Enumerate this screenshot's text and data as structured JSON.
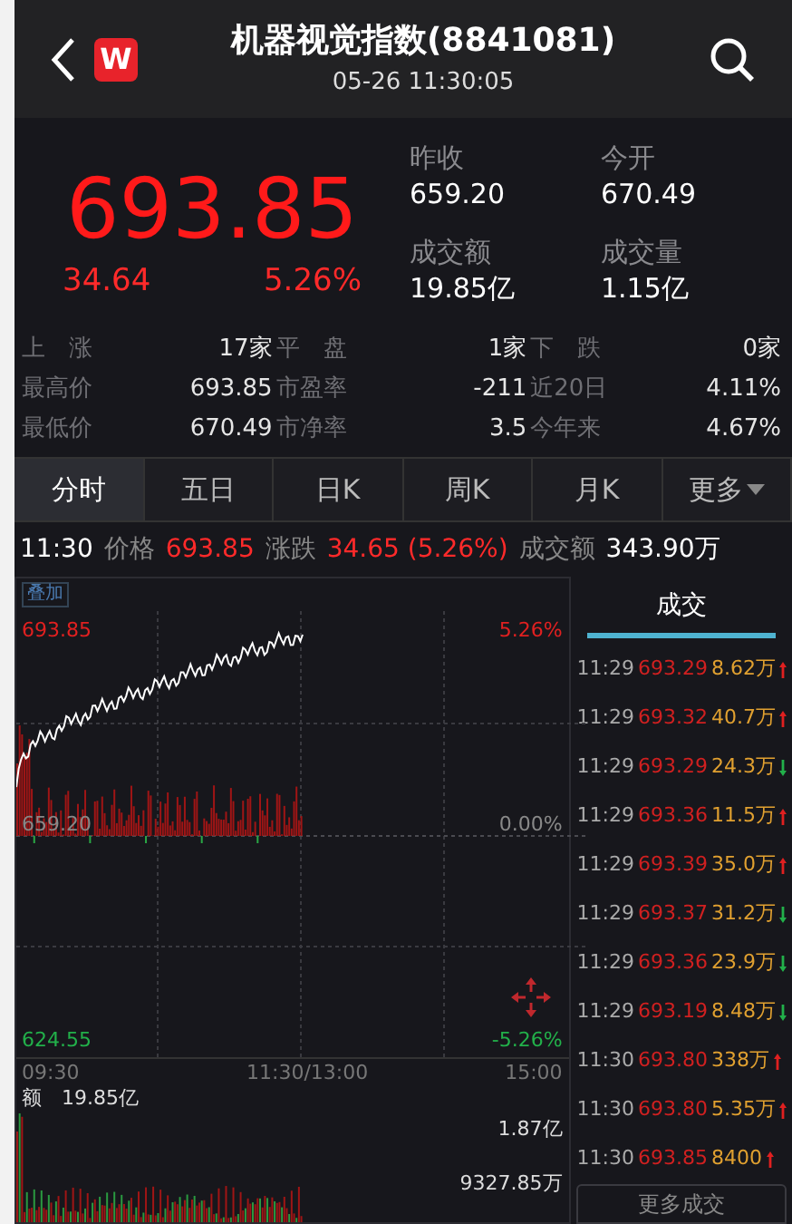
{
  "header": {
    "title": "机器视觉指数(8841081)",
    "time": "05-26 11:30:05",
    "logo": "W"
  },
  "quote": {
    "price": "693.85",
    "change": "34.64",
    "change_pct": "5.26%"
  },
  "summary": [
    {
      "label": "昨收",
      "value": "659.20"
    },
    {
      "label": "今开",
      "value": "670.49"
    },
    {
      "label": "成交额",
      "value": "19.85亿"
    },
    {
      "label": "成交量",
      "value": "1.15亿"
    }
  ],
  "stats": [
    [
      {
        "label": "上　涨",
        "value": "17家"
      },
      {
        "label": "平　盘",
        "value": "1家"
      },
      {
        "label": "下　跌",
        "value": "0家"
      }
    ],
    [
      {
        "label": "最高价",
        "value": "693.85"
      },
      {
        "label": "市盈率",
        "value": "-211"
      },
      {
        "label": "近20日",
        "value": "4.11%"
      }
    ],
    [
      {
        "label": "最低价",
        "value": "670.49"
      },
      {
        "label": "市净率",
        "value": "3.5"
      },
      {
        "label": "今年来",
        "value": "4.67%"
      }
    ]
  ],
  "tabs": [
    {
      "label": "分时",
      "selected": true
    },
    {
      "label": "五日",
      "selected": false
    },
    {
      "label": "日K",
      "selected": false
    },
    {
      "label": "周K",
      "selected": false
    },
    {
      "label": "月K",
      "selected": false
    },
    {
      "label": "更多",
      "selected": false
    }
  ],
  "info_line": {
    "time": "11:30",
    "price_label": "价格",
    "price": "693.85",
    "change_label": "涨跌",
    "change": "34.65 (5.26%)",
    "amount_label": "成交额",
    "amount": "343.90万"
  },
  "chart": {
    "overlay_button": "叠加",
    "high": "693.85",
    "high_pct": "5.26%",
    "base": "659.20",
    "base_pct": "0.00%",
    "low": "624.55",
    "low_pct": "-5.26%",
    "time_start": "09:30",
    "time_mid": "11:30/13:00",
    "time_end": "15:00",
    "amount_label": "额",
    "amount": "19.85亿",
    "vol_high": "1.87亿",
    "vol_mid": "9327.85万"
  },
  "trades_title": "成交",
  "trades": [
    {
      "time": "11:29",
      "price": "693.29",
      "volume": "8.62万",
      "up": true
    },
    {
      "time": "11:29",
      "price": "693.32",
      "volume": "40.7万",
      "up": true
    },
    {
      "time": "11:29",
      "price": "693.29",
      "volume": "24.3万",
      "up": false
    },
    {
      "time": "11:29",
      "price": "693.36",
      "volume": "11.5万",
      "up": true
    },
    {
      "time": "11:29",
      "price": "693.39",
      "volume": "35.0万",
      "up": true
    },
    {
      "time": "11:29",
      "price": "693.37",
      "volume": "31.2万",
      "up": false
    },
    {
      "time": "11:29",
      "price": "693.36",
      "volume": "23.9万",
      "up": false
    },
    {
      "time": "11:29",
      "price": "693.19",
      "volume": "8.48万",
      "up": false
    },
    {
      "time": "11:30",
      "price": "693.80",
      "volume": "338万",
      "up": true
    },
    {
      "time": "11:30",
      "price": "693.80",
      "volume": "5.35万",
      "up": true
    },
    {
      "time": "11:30",
      "price": "693.85",
      "volume": "8400",
      "up": true
    }
  ],
  "more_trades": "更多成交"
}
